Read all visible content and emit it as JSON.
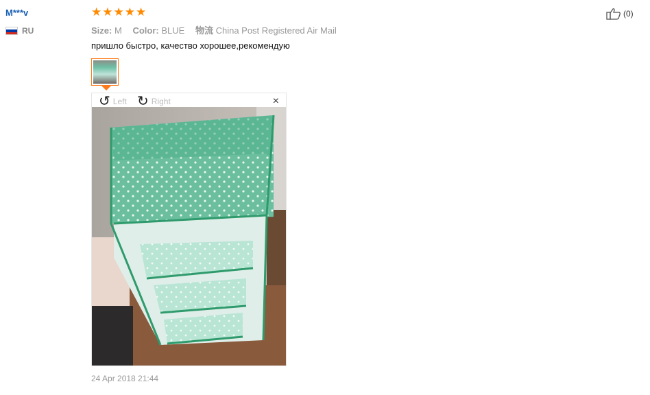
{
  "review": {
    "user": "M***v",
    "country_code": "RU",
    "rating": 5,
    "size_label": "Size:",
    "size_value": "M",
    "color_label": "Color:",
    "color_value": "BLUE",
    "shipping_label": "物流",
    "shipping_value": "China Post Registered Air Mail",
    "text": "пришло быстро, качество хорошее,рекомендую",
    "likes": "(0)",
    "date": "24 Apr 2018 21:44"
  },
  "viewer": {
    "left_label": "Left",
    "right_label": "Right",
    "close_label": "×"
  },
  "colors": {
    "star": "#ff8a00",
    "username": "#1a5fb4",
    "accent_border": "#ff7a1a"
  },
  "icons": [
    "russia-flag-icon",
    "star-icon",
    "rotate-left-icon",
    "rotate-right-icon",
    "close-icon",
    "thumbs-up-icon"
  ]
}
